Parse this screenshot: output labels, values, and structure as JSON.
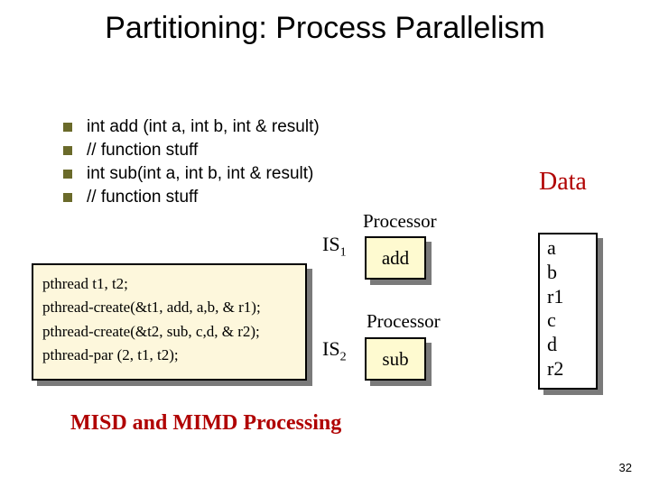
{
  "title": "Partitioning: Process Parallelism",
  "bullets": [
    "int add (int a, int b, int & result)",
    "// function stuff",
    "int sub(int a, int b, int & result)",
    "// function stuff"
  ],
  "pthread": {
    "l1": "pthread t1, t2;",
    "l2": "pthread-create(&t1, add, a,b, & r1);",
    "l3": "pthread-create(&t2, sub, c,d, & r2);",
    "l4": "pthread-par (2, t1, t2);"
  },
  "labels": {
    "is1_prefix": "IS",
    "is1_sub": "1",
    "is2_prefix": "IS",
    "is2_sub": "2",
    "processor1": "Processor",
    "processor2": "Processor",
    "data": "Data",
    "add": "add",
    "sub": "sub"
  },
  "data_items": {
    "d1": "a",
    "d2": "b",
    "d3": "r1",
    "d4": "c",
    "d5": "d",
    "d6": "r2"
  },
  "footer": "MISD and MIMD Processing",
  "page": "32"
}
